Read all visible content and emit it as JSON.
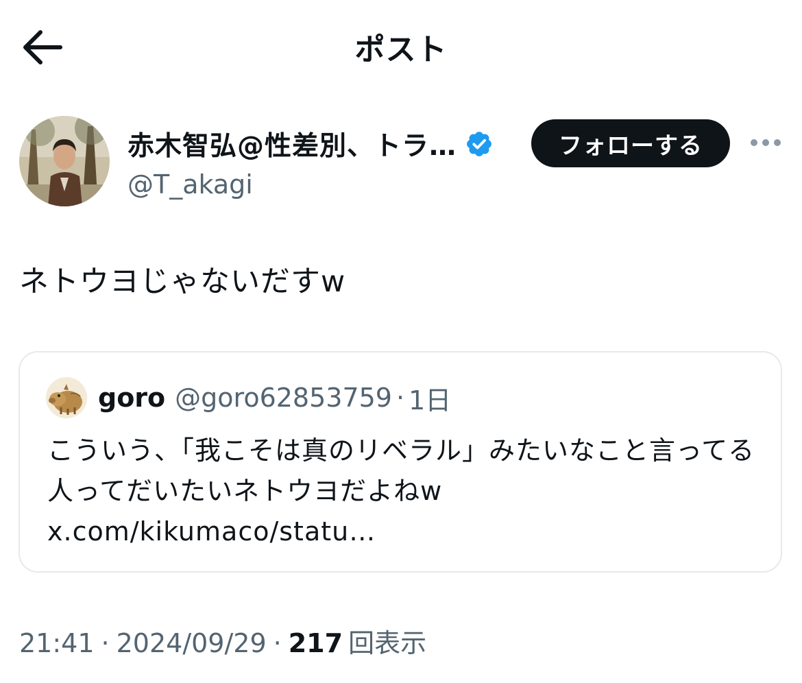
{
  "header": {
    "title": "ポスト"
  },
  "author": {
    "display_name": "赤木智弘@性差別、トラ…",
    "handle": "@T_akagi",
    "follow_label": "フォローする"
  },
  "post": {
    "text": "ネトウヨじゃないだすw"
  },
  "quote": {
    "name": "goro",
    "handle": "@goro62853759",
    "separator": "·",
    "time": "1日",
    "text": "こういう、「我こそは真のリベラル」みたいなこと言ってる人ってだいたいネトウヨだよねw x.com/kikumaco/statu…"
  },
  "meta": {
    "time": "21:41",
    "date": "2024/09/29",
    "separator": "·",
    "views_count": "217",
    "views_label": "回表示"
  },
  "colors": {
    "text": "#0f1419",
    "secondary": "#536471",
    "verified": "#1d9bf0",
    "follow_bg": "#0f1419",
    "border": "#e6e9ec"
  },
  "icons": {
    "back": "arrow-left-icon",
    "verified": "verified-badge-icon",
    "more": "more-horizontal-icon"
  }
}
